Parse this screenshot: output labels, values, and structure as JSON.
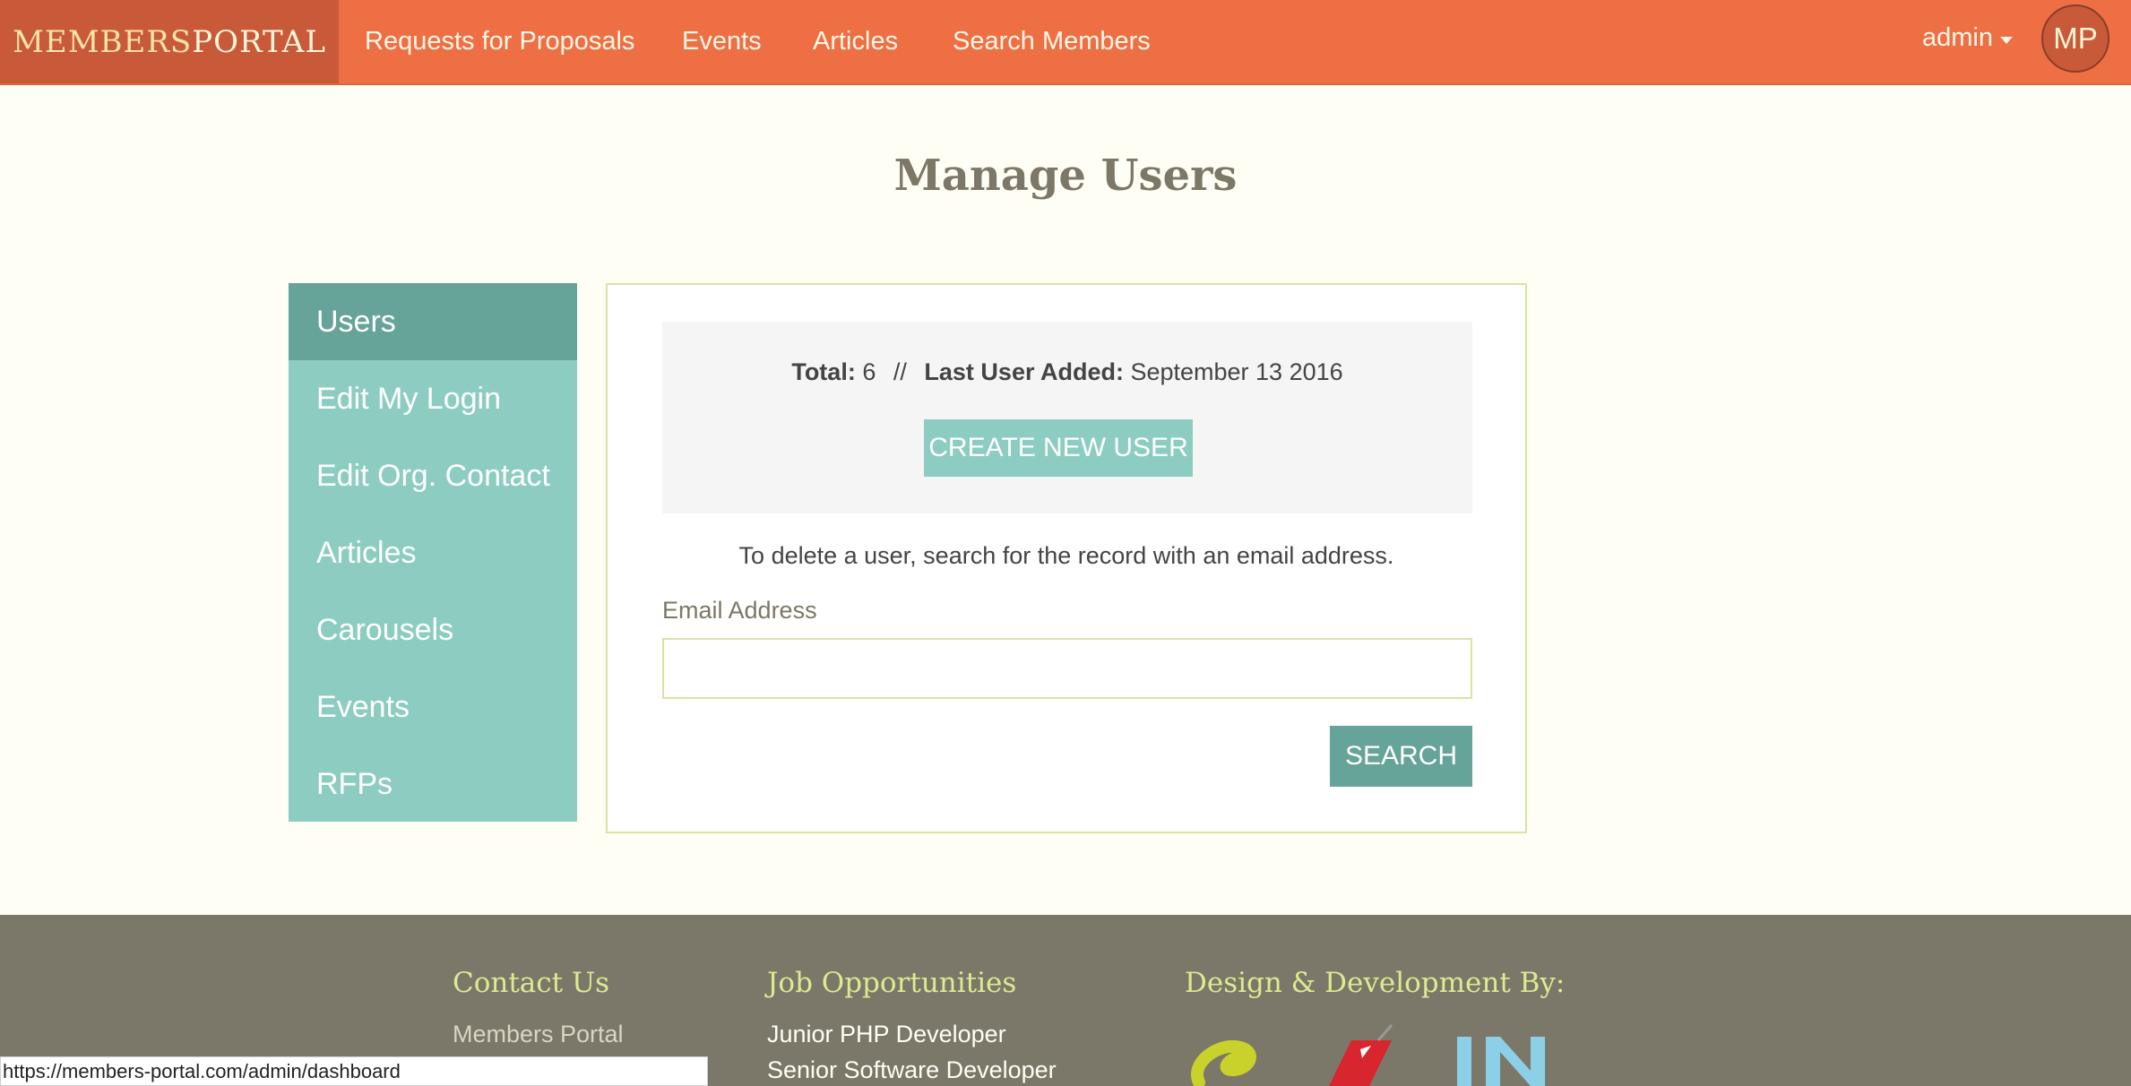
{
  "brand": {
    "part1": "MEMBERS",
    "part2": "PORTAL"
  },
  "nav": {
    "links": [
      "Requests for Proposals",
      "Events",
      "Articles",
      "Search Members"
    ],
    "user_menu": "admin",
    "avatar_initials": "MP"
  },
  "page": {
    "title": "Manage Users"
  },
  "sidebar": {
    "items": [
      {
        "label": "Users",
        "active": true
      },
      {
        "label": "Edit My Login"
      },
      {
        "label": "Edit Org. Contact"
      },
      {
        "label": "Articles"
      },
      {
        "label": "Carousels"
      },
      {
        "label": "Events"
      },
      {
        "label": "RFPs"
      }
    ]
  },
  "summary": {
    "total_label": "Total:",
    "total_value": "6",
    "separator": "//",
    "last_added_label": "Last User Added:",
    "last_added_value": "September 13 2016",
    "create_button": "CREATE NEW USER"
  },
  "search": {
    "help_text": "To delete a user, search for the record with an email address.",
    "email_label": "Email Address",
    "email_value": "",
    "button": "SEARCH"
  },
  "footer": {
    "contact_heading": "Contact Us",
    "contact_link": "Members Portal",
    "jobs_heading": "Job Opportunities",
    "jobs": [
      "Junior PHP Developer",
      "Senior Software Developer"
    ],
    "credits_heading": "Design & Development By:"
  },
  "status_url": "https://members-portal.com/admin/dashboard",
  "colors": {
    "nav_bg": "#ee6f44",
    "brand_bg": "#c85a39",
    "sidebar_bg": "#8dcdc1",
    "sidebar_active": "#66a398",
    "footer_bg": "#7b7869",
    "footer_heading": "#dfe98f"
  }
}
